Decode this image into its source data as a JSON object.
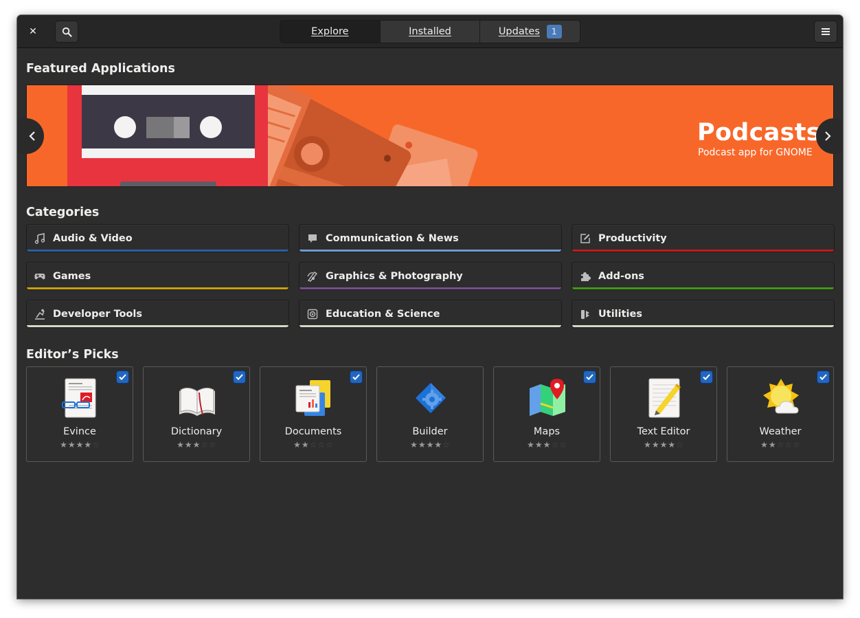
{
  "header": {
    "tabs": [
      {
        "label": "Explore",
        "active": true
      },
      {
        "label": "Installed",
        "active": false
      },
      {
        "label": "Updates",
        "badge": "1",
        "active": false
      }
    ],
    "icons": {
      "close": "close-icon",
      "search": "search-icon",
      "menu": "hamburger-menu-icon"
    }
  },
  "featured": {
    "section_title": "Featured Applications",
    "title": "Podcasts",
    "subtitle": "Podcast app for GNOME",
    "background": "#f8672a"
  },
  "categories": {
    "section_title": "Categories",
    "items": [
      {
        "label": "Audio & Video",
        "icon": "music-note-icon",
        "color": "#2d5e9f"
      },
      {
        "label": "Communication & News",
        "icon": "chat-bubble-icon",
        "color": "#6e9bd0"
      },
      {
        "label": "Productivity",
        "icon": "edit-document-icon",
        "color": "#c01c1c"
      },
      {
        "label": "Games",
        "icon": "gamepad-icon",
        "color": "#c9a010"
      },
      {
        "label": "Graphics & Photography",
        "icon": "palette-icon",
        "color": "#7a4e8e"
      },
      {
        "label": "Add-ons",
        "icon": "puzzle-piece-icon",
        "color": "#3f9a14"
      },
      {
        "label": "Developer Tools",
        "icon": "developer-tools-icon",
        "color": "#d8d8c8"
      },
      {
        "label": "Education & Science",
        "icon": "education-icon",
        "color": "#d8d8c8"
      },
      {
        "label": "Utilities",
        "icon": "utilities-icon",
        "color": "#d8d8c8"
      }
    ]
  },
  "picks": {
    "section_title": "Editor’s Picks",
    "items": [
      {
        "name": "Evince",
        "icon": "evince-icon",
        "rating": 4
      },
      {
        "name": "Dictionary",
        "icon": "dictionary-icon",
        "rating": 3
      },
      {
        "name": "Documents",
        "icon": "documents-icon",
        "rating": 2
      },
      {
        "name": "Builder",
        "icon": "builder-icon",
        "rating": 4
      },
      {
        "name": "Maps",
        "icon": "maps-icon",
        "rating": 3
      },
      {
        "name": "Text Editor",
        "icon": "text-editor-icon",
        "rating": 4
      },
      {
        "name": "Weather",
        "icon": "weather-icon",
        "rating": 2
      }
    ]
  }
}
